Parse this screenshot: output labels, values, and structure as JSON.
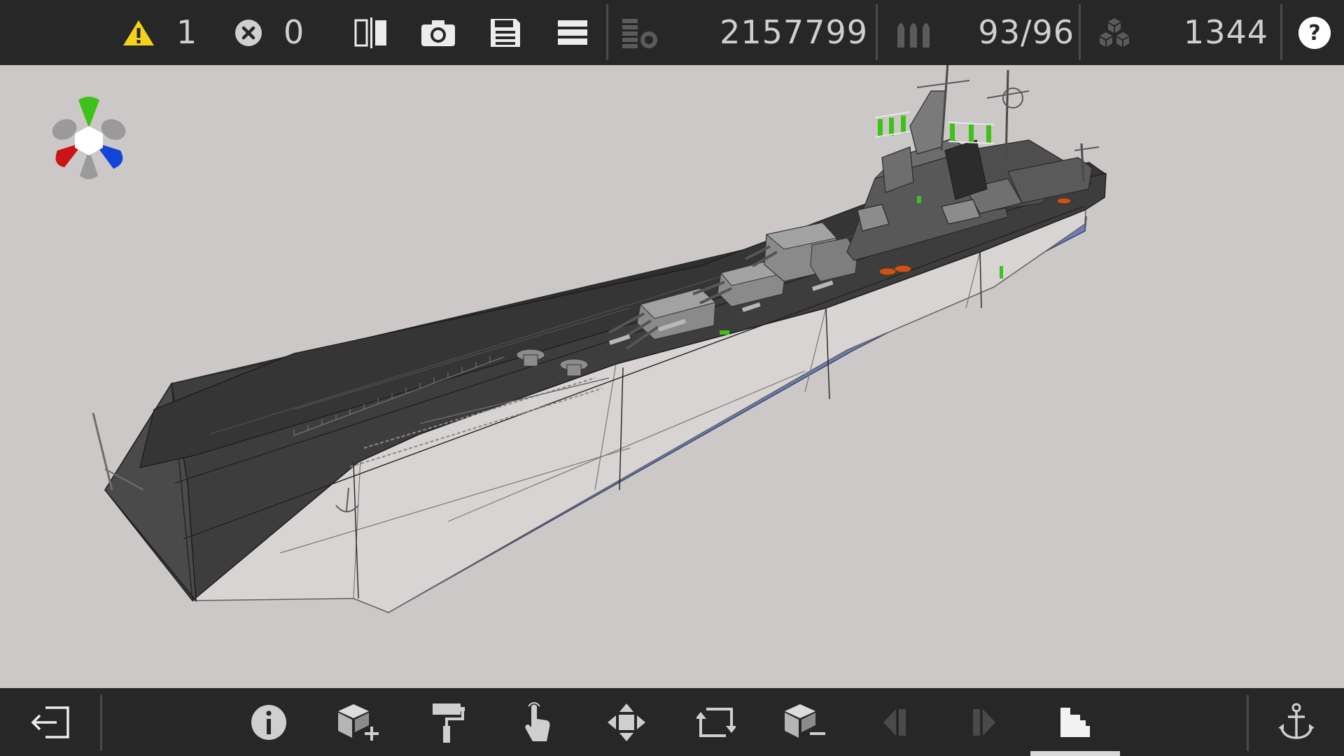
{
  "topbar": {
    "warning_icon": "warning-triangle-icon",
    "warning_count": "1",
    "error_icon": "error-x-circle-icon",
    "error_count": "0",
    "tools": [
      {
        "name": "mirror-symmetry-icon"
      },
      {
        "name": "camera-icon"
      },
      {
        "name": "save-icon"
      },
      {
        "name": "menu-icon"
      }
    ],
    "cost_icon": "coin-stack-icon",
    "cost_value": "2157799",
    "ammo_icon": "shells-icon",
    "ammo_value": "93/96",
    "blocks_icon": "blocks-icon",
    "blocks_value": "1344",
    "help_label": "?"
  },
  "bottombar": {
    "tools": [
      {
        "name": "exit-icon"
      },
      {
        "name": "info-icon",
        "label": "i"
      },
      {
        "name": "add-block-icon"
      },
      {
        "name": "paint-roller-icon"
      },
      {
        "name": "select-hand-icon"
      },
      {
        "name": "move-icon"
      },
      {
        "name": "rotate-icon"
      },
      {
        "name": "remove-block-icon"
      },
      {
        "name": "undo-icon"
      },
      {
        "name": "redo-icon"
      },
      {
        "name": "view-mode-icon"
      },
      {
        "name": "anchor-icon"
      }
    ],
    "active_tool": "view-mode-icon"
  },
  "colors": {
    "bar_bg": "#272727",
    "viewport_bg": "#cbc8c7",
    "warning": "#f2d21c",
    "hull_dark": "#3a3a3a",
    "hull_light": "#d9d4d4",
    "keel_blue": "#6f7eb0",
    "axis_x": "#c91515",
    "axis_y": "#3ec21a",
    "axis_z": "#1545d6"
  }
}
